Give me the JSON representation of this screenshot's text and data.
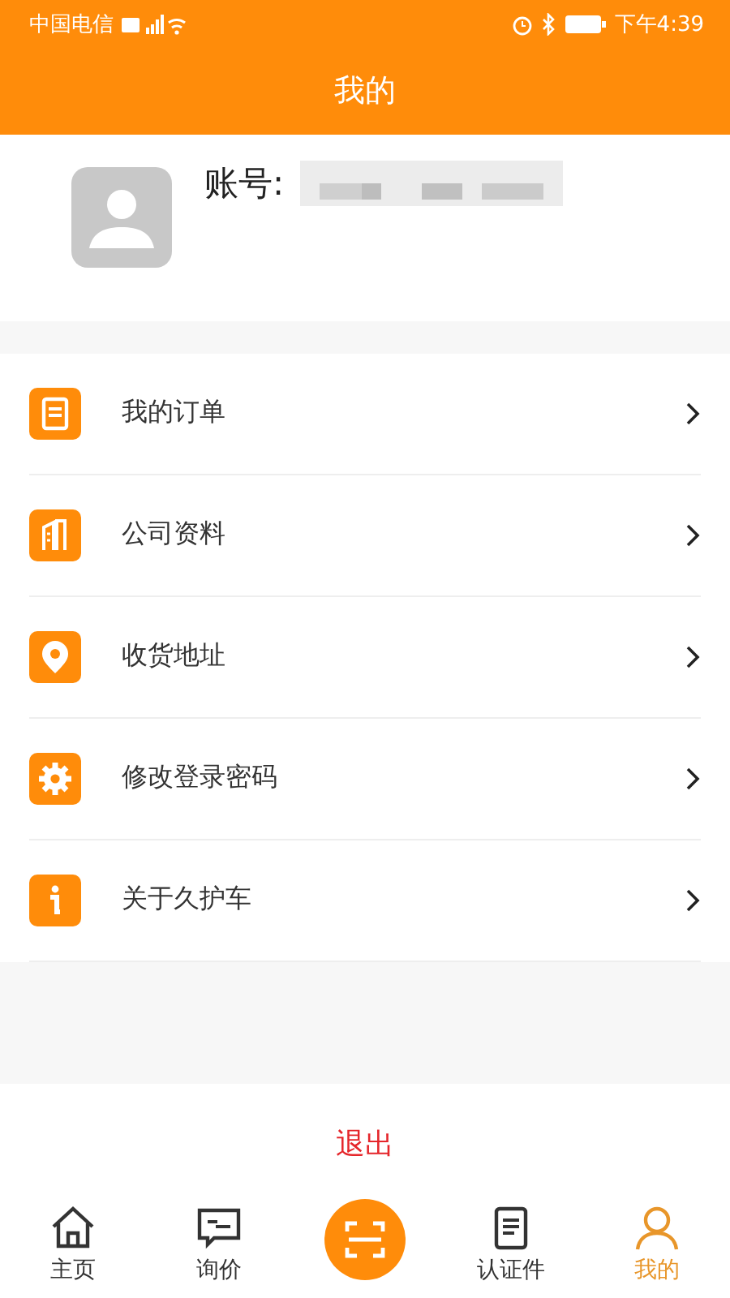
{
  "status_bar": {
    "carrier": "中国电信",
    "time": "下午4:39"
  },
  "header": {
    "title": "我的"
  },
  "profile": {
    "account_label": "账号:"
  },
  "menu": [
    {
      "label": "我的订单",
      "kind": "order"
    },
    {
      "label": "公司资料",
      "kind": "company"
    },
    {
      "label": "收货地址",
      "kind": "address"
    },
    {
      "label": "修改登录密码",
      "kind": "password"
    },
    {
      "label": "关于久护车",
      "kind": "about"
    }
  ],
  "logout": "退出",
  "tabs": [
    {
      "label": "主页",
      "kind": "home",
      "selected": false
    },
    {
      "label": "询价",
      "kind": "inquiry",
      "selected": false
    },
    {
      "kind": "scan",
      "selected": false
    },
    {
      "label": "认证件",
      "kind": "certificate",
      "selected": false
    },
    {
      "label": "我的",
      "kind": "profile",
      "selected": true
    }
  ]
}
